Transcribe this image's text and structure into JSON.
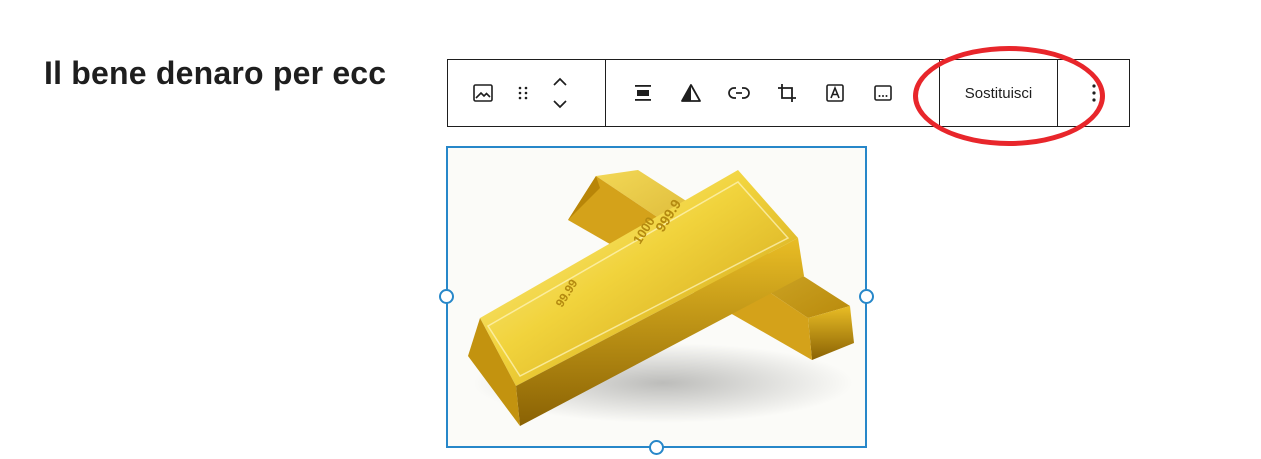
{
  "post": {
    "heading_visible": "Il bene denaro per ecc"
  },
  "toolbar": {
    "buttons": [
      {
        "name": "image-block-icon"
      },
      {
        "name": "drag-handle-icon"
      },
      {
        "name": "move-up-icon"
      },
      {
        "name": "move-down-icon"
      },
      {
        "name": "align-icon"
      },
      {
        "name": "duotone-filter-icon"
      },
      {
        "name": "link-icon"
      },
      {
        "name": "crop-icon"
      },
      {
        "name": "text-overlay-icon"
      },
      {
        "name": "alt-text-icon"
      }
    ],
    "replace_label": "Sostituisci",
    "more_options": "more-vertical-icon"
  },
  "image": {
    "subject": "gold-bars",
    "engraving_1": "999.9",
    "engraving_2": "1000",
    "engraving_3": "99.99"
  },
  "colors": {
    "selection": "#2787c9",
    "annotation": "#e8262b",
    "toolbar_border": "#1e1e1e",
    "gold_light": "#f5df5a",
    "gold_mid": "#d9ad1a",
    "gold_dark": "#9a6f06"
  }
}
